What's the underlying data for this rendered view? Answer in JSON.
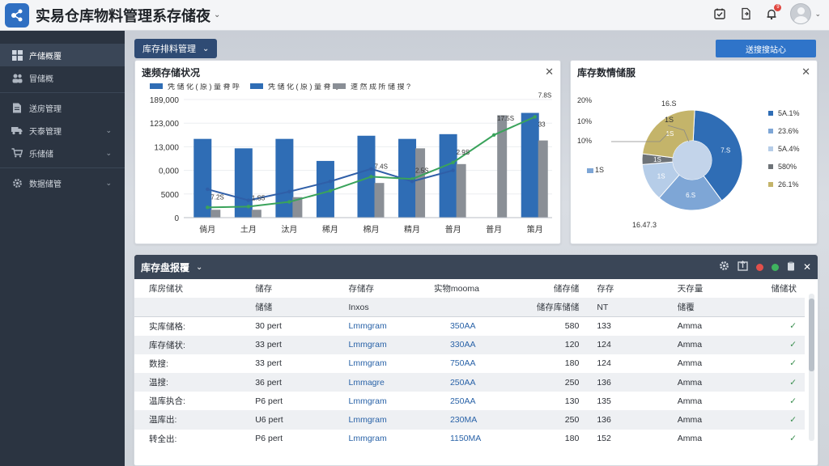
{
  "header": {
    "app_title": "实易仓库物料管理系存储夜",
    "title_caret": "⌄",
    "notification_count": "9"
  },
  "sidebar": {
    "items": [
      {
        "label": "产储概覆",
        "icon": "dashboard-icon",
        "active": true,
        "chevron": ""
      },
      {
        "label": "冒储概",
        "icon": "users-icon",
        "active": false,
        "chevron": ""
      },
      {
        "label": "送房管理",
        "icon": "document-icon",
        "active": false,
        "chevron": ""
      },
      {
        "label": "天泰管理",
        "icon": "truck-icon",
        "active": false,
        "chevron": "⌄"
      },
      {
        "label": "乐储储",
        "icon": "cart-icon",
        "active": false,
        "chevron": "⌄"
      },
      {
        "label": "数据储管",
        "icon": "gear-icon",
        "active": false,
        "chevron": "⌄"
      }
    ]
  },
  "toolbar": {
    "pill_label": "库存排料管理",
    "primary_button": "送搜搜站心"
  },
  "bar_panel": {
    "title": "速频存储状况",
    "legend": [
      "凭 储 化 ( 原 ) 量 脊 呼",
      "山匠当 ) 辑 陈 ?",
      "速 然 成 所 储 搜 ?"
    ]
  },
  "pie_panel": {
    "title": "库存数情储服"
  },
  "table_panel": {
    "title": "库存盘报覆",
    "header1": [
      "库房储状",
      "储存",
      "存储存",
      "实物mooma",
      "储存储",
      "存存",
      "天存量",
      "储储状"
    ],
    "header2": [
      "",
      "储储",
      "Inxos",
      "",
      "储存库储储",
      "NT",
      "储覆",
      ""
    ],
    "rows": [
      [
        "实库储格:",
        "30 pert",
        "Lmmgram",
        "350AA",
        "580",
        "133",
        "Amma",
        "✓"
      ],
      [
        "库存储状:",
        "33 pert",
        "Lmmgram",
        "330AA",
        "120",
        "124",
        "Amma",
        "✓"
      ],
      [
        "数搜:",
        "33 pert",
        "Lmmgram",
        "750AA",
        "180",
        "124",
        "Amma",
        "✓"
      ],
      [
        "温搜:",
        "36 pert",
        "Lmmagre",
        "250AA",
        "250",
        "136",
        "Amma",
        "✓"
      ],
      [
        "温库执合:",
        "P6 pert",
        "Lmmgram",
        "250AA",
        "130",
        "135",
        "Amma",
        "✓"
      ],
      [
        "温库出:",
        "U6 pert",
        "Lmmgram",
        "230MA",
        "250",
        "136",
        "Amma",
        "✓"
      ],
      [
        "转全出:",
        "P6 pert",
        "Lmmgram",
        "1150MA",
        "180",
        "152",
        "Amma",
        "✓"
      ]
    ]
  },
  "colors": {
    "bar_blue": "#2f6db5",
    "bar_gray": "#8a8f96",
    "line_green": "#3aa35b",
    "line_blue": "#2f5fa8",
    "sidebar_bg": "#2b3441",
    "accent": "#2f74c9"
  },
  "chart_data": [
    {
      "type": "bar",
      "title": "速频存储状况",
      "categories": [
        "倘月",
        "土月",
        "汰月",
        "稀月",
        "棉月",
        "精月",
        "普月",
        "普月",
        "策月"
      ],
      "yticks": [
        "189,000",
        "123,000",
        "13,000",
        "0,000",
        "5000",
        "0"
      ],
      "ylim": [
        0,
        15000
      ],
      "series": [
        {
          "name": "凭 储 化 ( 原 ) 量 脊 呼",
          "kind": "bar",
          "values": [
            10000,
            8800,
            10000,
            7200,
            10400,
            10000,
            10600,
            0,
            13300
          ]
        },
        {
          "name": "速 然 成 所 储 搜 ?",
          "kind": "bar",
          "values": [
            1000,
            1000,
            2600,
            0,
            4400,
            8800,
            6800,
            13000,
            9800
          ]
        },
        {
          "name": "",
          "kind": "line",
          "values": [
            1300,
            1400,
            2000,
            3400,
            5200,
            4900,
            7000,
            10500,
            12800
          ]
        },
        {
          "name": "",
          "kind": "line",
          "values": [
            3600,
            2200,
            3300,
            4600,
            6200,
            4600,
            6000,
            0,
            0
          ]
        }
      ],
      "annotations": [
        "7.2S",
        "1.S5",
        "7.4S",
        "2.5S",
        "2.9S",
        "17.5S",
        "7.8S",
        "33"
      ]
    },
    {
      "type": "pie",
      "title": "库存数情储服",
      "values": [
        43.1,
        23.6,
        13.4,
        3.8,
        26.1
      ],
      "legend": [
        "5A.1%",
        "23.6%",
        "5A.4%",
        "580%",
        "26.1%"
      ],
      "slice_labels": [
        "7.S",
        "6.S",
        "1S",
        "1S",
        "1S"
      ],
      "callouts": [
        "20%",
        "10%",
        "10%",
        "16.S",
        "1S",
        "1S",
        "16.47.3",
        "16.47.3"
      ],
      "colors": [
        "#2f6db5",
        "#7ea6d6",
        "#b6cde8",
        "#6e7378",
        "#c4b46a"
      ]
    }
  ]
}
